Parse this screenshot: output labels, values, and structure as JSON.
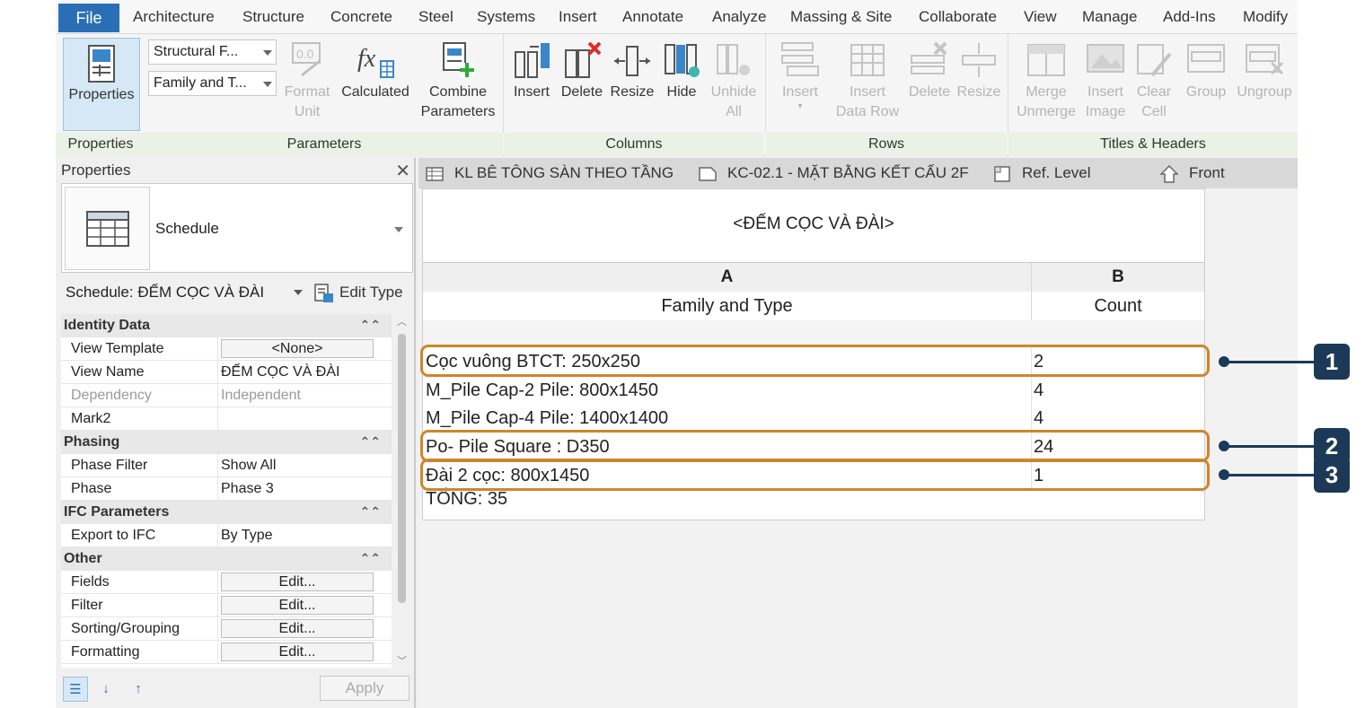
{
  "menu": {
    "file": "File",
    "items": [
      "Architecture",
      "Structure",
      "Concrete",
      "Steel",
      "Systems",
      "Insert",
      "Annotate",
      "Analyze",
      "Massing & Site",
      "Collaborate",
      "View",
      "Manage",
      "Add-Ins",
      "Modify"
    ]
  },
  "ribbon": {
    "properties_btn": "Properties",
    "combo1": "Structural F...",
    "combo2": "Family and T...",
    "format_unit_1": "Format",
    "format_unit_2": "Unit",
    "calculated": "Calculated",
    "combine_1": "Combine",
    "combine_2": "Parameters",
    "insert": "Insert",
    "delete": "Delete",
    "resize": "Resize",
    "hide": "Hide",
    "unhide_1": "Unhide",
    "unhide_2": "All",
    "rows_insert": "Insert",
    "rows_insert_data_1": "Insert",
    "rows_insert_data_2": "Data Row",
    "rows_delete": "Delete",
    "rows_resize": "Resize",
    "merge_1": "Merge",
    "merge_2": "Unmerge",
    "insert_image_1": "Insert",
    "insert_image_2": "Image",
    "clear_cell_1": "Clear",
    "clear_cell_2": "Cell",
    "group": "Group",
    "ungroup": "Ungroup",
    "panels": {
      "properties": "Properties",
      "parameters": "Parameters",
      "columns": "Columns",
      "rows": "Rows",
      "titles": "Titles & Headers"
    }
  },
  "properties": {
    "title": "Properties",
    "type_name": "Schedule",
    "instance_selector": "Schedule: ĐẾM CỌC VÀ ĐÀI",
    "edit_type": "Edit Type",
    "groups": {
      "identity": "Identity Data",
      "phasing": "Phasing",
      "ifc": "IFC Parameters",
      "other": "Other"
    },
    "rows": {
      "view_template": {
        "name": "View Template",
        "value": "<None>"
      },
      "view_name": {
        "name": "View Name",
        "value": "ĐẾM CỌC VÀ ĐÀI"
      },
      "dependency": {
        "name": "Dependency",
        "value": "Independent"
      },
      "mark2": {
        "name": "Mark2",
        "value": ""
      },
      "phase_filter": {
        "name": "Phase Filter",
        "value": "Show All"
      },
      "phase": {
        "name": "Phase",
        "value": "Phase 3"
      },
      "export_ifc": {
        "name": "Export to IFC",
        "value": "By Type"
      },
      "fields": {
        "name": "Fields",
        "value": "Edit..."
      },
      "filter": {
        "name": "Filter",
        "value": "Edit..."
      },
      "sorting": {
        "name": "Sorting/Grouping",
        "value": "Edit..."
      },
      "formatting": {
        "name": "Formatting",
        "value": "Edit..."
      }
    },
    "apply": "Apply"
  },
  "view_tabs": [
    "KL BÊ TÔNG SÀN THEO TẦNG",
    "KC-02.1 - MẶT BẰNG KẾT CẤU 2F",
    "Ref. Level",
    "Front"
  ],
  "schedule": {
    "title": "<ĐẾM CỌC VÀ ĐÀI>",
    "col_a_letter": "A",
    "col_b_letter": "B",
    "col_a_name": "Family and Type",
    "col_b_name": "Count",
    "rows": [
      {
        "family": "Cọc vuông BTCT: 250x250",
        "count": "2"
      },
      {
        "family": "M_Pile Cap-2 Pile: 800x1450",
        "count": "4"
      },
      {
        "family": "M_Pile Cap-4 Pile: 1400x1400",
        "count": "4"
      },
      {
        "family": "Po- Pile Square  : D350",
        "count": "24"
      },
      {
        "family": "Đài 2 cọc: 800x1450",
        "count": "1"
      }
    ],
    "total": "TỔNG: 35"
  },
  "callouts": [
    "1",
    "2",
    "3"
  ],
  "colors": {
    "accent": "#2a6fb5",
    "highlight": "#d0852b",
    "badge": "#1c3a58"
  }
}
